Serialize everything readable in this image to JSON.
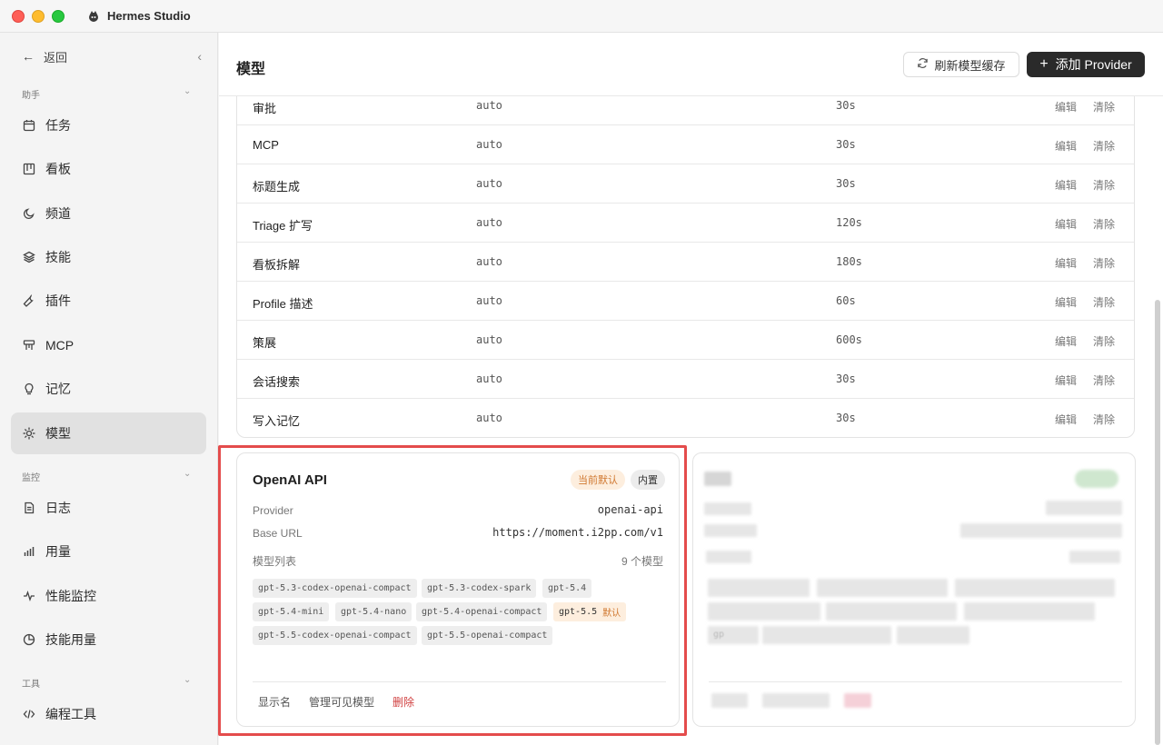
{
  "window": {
    "title": "Hermes Studio"
  },
  "sidebar": {
    "back_label": "返回",
    "sections": [
      {
        "label": "助手"
      },
      {
        "label": "监控"
      },
      {
        "label": "工具"
      }
    ],
    "items": [
      {
        "label": "任务",
        "icon": "calendar-icon"
      },
      {
        "label": "看板",
        "icon": "kanban-icon"
      },
      {
        "label": "频道",
        "icon": "moon-icon"
      },
      {
        "label": "技能",
        "icon": "layers-icon"
      },
      {
        "label": "插件",
        "icon": "wrench-icon"
      },
      {
        "label": "MCP",
        "icon": "plug-icon"
      },
      {
        "label": "记忆",
        "icon": "lightbulb-icon"
      },
      {
        "label": "模型",
        "icon": "sparkle-icon",
        "active": true
      },
      {
        "label": "日志",
        "icon": "document-icon"
      },
      {
        "label": "用量",
        "icon": "bar-chart-icon"
      },
      {
        "label": "性能监控",
        "icon": "activity-icon"
      },
      {
        "label": "技能用量",
        "icon": "pie-chart-icon"
      },
      {
        "label": "编程工具",
        "icon": "code-icon"
      }
    ]
  },
  "header": {
    "title": "模型",
    "refresh_label": "刷新模型缓存",
    "add_label": "添加 Provider"
  },
  "tasks_table": {
    "edit_label": "编辑",
    "clear_label": "清除",
    "rows": [
      {
        "name": "审批",
        "model": "auto",
        "timeout": "30s"
      },
      {
        "name": "MCP",
        "model": "auto",
        "timeout": "30s"
      },
      {
        "name": "标题生成",
        "model": "auto",
        "timeout": "30s"
      },
      {
        "name": "Triage 扩写",
        "model": "auto",
        "timeout": "120s"
      },
      {
        "name": "看板拆解",
        "model": "auto",
        "timeout": "180s"
      },
      {
        "name": "Profile 描述",
        "model": "auto",
        "timeout": "60s"
      },
      {
        "name": "策展",
        "model": "auto",
        "timeout": "600s"
      },
      {
        "name": "会话搜索",
        "model": "auto",
        "timeout": "30s"
      },
      {
        "name": "写入记忆",
        "model": "auto",
        "timeout": "30s"
      }
    ]
  },
  "provider_card": {
    "name": "OpenAI API",
    "badge_default": "当前默认",
    "badge_builtin": "内置",
    "provider_label": "Provider",
    "provider_value": "openai-api",
    "base_url_label": "Base URL",
    "base_url_value": "https://moment.i2pp.com/v1",
    "models_label": "模型列表",
    "models_count": "9 个模型",
    "default_tag": "默认",
    "models": [
      "gpt-5.3-codex-openai-compact",
      "gpt-5.3-codex-spark",
      "gpt-5.4",
      "gpt-5.4-mini",
      "gpt-5.4-nano",
      "gpt-5.4-openai-compact",
      "gpt-5.5",
      "gpt-5.5-codex-openai-compact",
      "gpt-5.5-openai-compact"
    ],
    "default_model": "gpt-5.5",
    "actions": {
      "display_name": "显示名",
      "manage_models": "管理可见模型",
      "delete": "删除"
    }
  },
  "blurred_card": {
    "partial_text": "gp"
  },
  "colors": {
    "accent_dark": "#2a2a2a",
    "highlight_border": "#e44c4c",
    "default_badge_bg": "#fdeede",
    "default_badge_text": "#d07830",
    "danger": "#d04040"
  }
}
